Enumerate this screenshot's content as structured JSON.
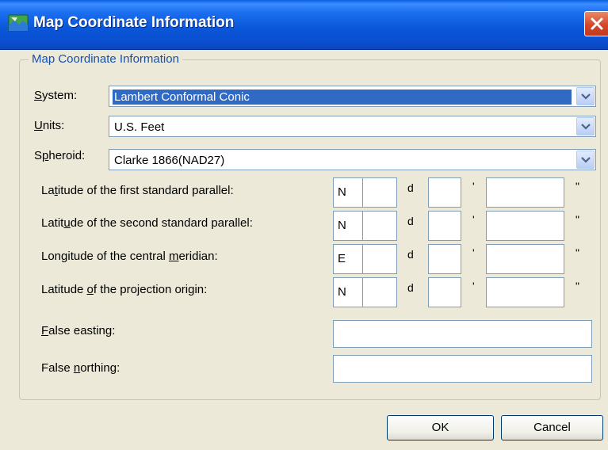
{
  "window": {
    "title": "Map Coordinate Information",
    "icon": "map-icon"
  },
  "group": {
    "legend": "Map Coordinate Information"
  },
  "system": {
    "label_u": "S",
    "label_rest": "ystem:",
    "value": "Lambert Conformal Conic"
  },
  "units": {
    "label_u": "U",
    "label_rest": "nits:",
    "value": "U.S. Feet"
  },
  "spheroid": {
    "label_pre": "S",
    "label_u": "p",
    "label_rest": "heroid:",
    "value": "Clarke 1866(NAD27)"
  },
  "params": [
    {
      "pre": "La",
      "u": "t",
      "post": "itude of the first standard parallel:",
      "dir": "N",
      "deg_unit": "d",
      "min_unit": "'",
      "sec_unit": "\""
    },
    {
      "pre": "Latit",
      "u": "u",
      "post": "de of the second standard parallel:",
      "dir": "N",
      "deg_unit": "d",
      "min_unit": "'",
      "sec_unit": "\""
    },
    {
      "pre": "Longitude of the central ",
      "u": "m",
      "post": "eridian:",
      "dir": "E",
      "deg_unit": "d",
      "min_unit": "'",
      "sec_unit": "\""
    },
    {
      "pre": "Latitude ",
      "u": "o",
      "post": "f the projection origin:",
      "dir": "N",
      "deg_unit": "d",
      "min_unit": "'",
      "sec_unit": "\""
    }
  ],
  "false_easting": {
    "u": "F",
    "rest": "alse easting:",
    "value": ""
  },
  "false_northing": {
    "pre": "False ",
    "u": "n",
    "rest": "orthing:",
    "value": ""
  },
  "buttons": {
    "ok": "OK",
    "cancel": "Cancel"
  }
}
